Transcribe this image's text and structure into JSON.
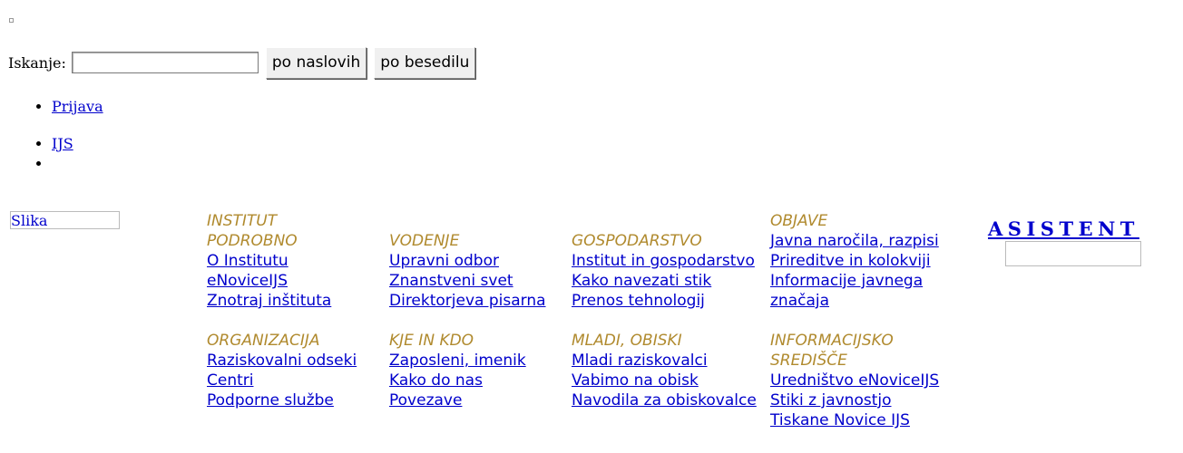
{
  "search": {
    "label": "Iskanje:",
    "value": "",
    "btn_titles": "po naslovih",
    "btn_text": "po besedilu"
  },
  "links1": [
    "Prijava"
  ],
  "links2": [
    "IJS",
    ""
  ],
  "image_alt": "Slika",
  "menu": {
    "col1": {
      "heading_a": "INSTITUT PODROBNO",
      "items_a": [
        "O Institutu",
        "eNoviceIJS",
        "Znotraj inštituta"
      ],
      "heading_b": "ORGANIZACIJA",
      "items_b": [
        "Raziskovalni odseki",
        "Centri",
        "Podporne službe"
      ]
    },
    "col2": {
      "heading_a": "VODENJE",
      "items_a": [
        "Upravni odbor",
        "Znanstveni svet",
        "Direktorjeva pisarna"
      ],
      "heading_b": "KJE IN KDO",
      "items_b": [
        "Zaposleni, imenik",
        "Kako do nas",
        "Povezave"
      ]
    },
    "col3": {
      "heading_a": "GOSPODARSTVO",
      "items_a": [
        "Institut in gospodarstvo",
        "Kako navezati stik",
        "Prenos tehnologij"
      ],
      "heading_b": "MLADI, OBISKI",
      "items_b": [
        "Mladi raziskovalci",
        "Vabimo na obisk",
        "Navodila za obiskovalce"
      ]
    },
    "col4": {
      "heading_a": "OBJAVE",
      "items_a": [
        "Javna naročila, razpisi",
        "Prireditve in kolokviji",
        "Informacije javnega značaja"
      ],
      "heading_b": "INFORMACIJSKO SREDIŠČE",
      "items_b": [
        "Uredništvo eNoviceIJS",
        "Stiki z javnostjo",
        "Tiskane Novice IJS"
      ]
    }
  },
  "asistent": {
    "title": "ASISTENT"
  },
  "colors": {
    "link": "#0000cc",
    "heading": "#b08a2e"
  }
}
